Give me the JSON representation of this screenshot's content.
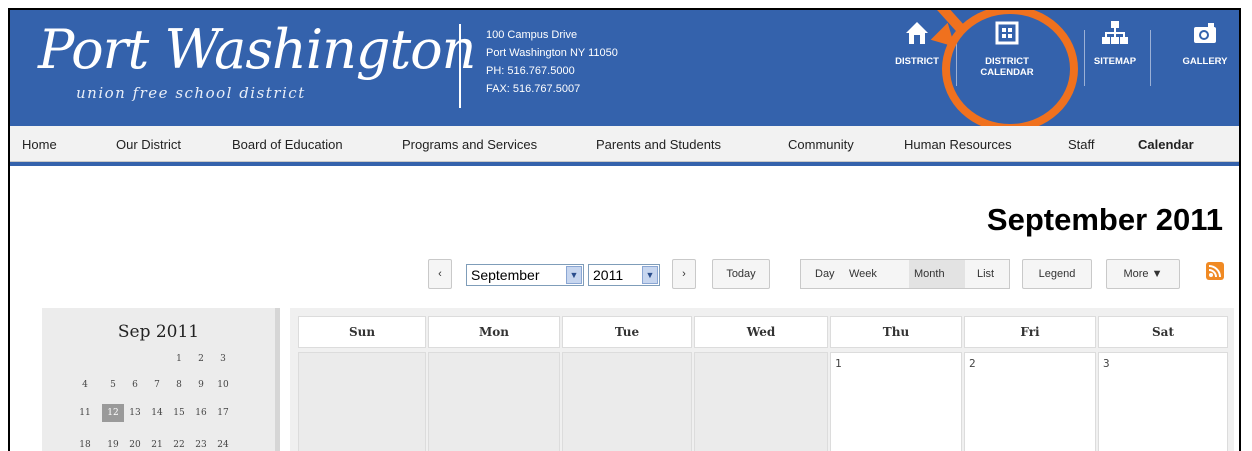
{
  "header": {
    "logo_main": "Port Washington",
    "logo_sub": "union free school district",
    "address": [
      "100 Campus Drive",
      "Port Washington NY 11050",
      "PH: 516.767.5000",
      "FAX: 516.767.5007"
    ],
    "links": [
      {
        "label": "DISTRICT",
        "icon": "house-icon"
      },
      {
        "label": "DISTRICT CALENDAR",
        "icon": "calendar-grid-icon"
      },
      {
        "label": "SITEMAP",
        "icon": "sitemap-icon"
      },
      {
        "label": "GALLERY",
        "icon": "camera-icon"
      }
    ],
    "highlight_color": "#f0711e",
    "bg_color": "#3462ac"
  },
  "nav": {
    "items": [
      "Home",
      "Our District",
      "Board of Education",
      "Programs and Services",
      "Parents and Students",
      "Community",
      "Human Resources",
      "Staff",
      "Calendar"
    ],
    "active": "Calendar"
  },
  "calendar": {
    "title": "September 2011",
    "prev": "‹",
    "next": "›",
    "month_select": "September",
    "year_select": "2011",
    "today": "Today",
    "views": [
      "Day",
      "Week",
      "Month",
      "List"
    ],
    "active_view": "Month",
    "legend": "Legend",
    "more": "More ▼",
    "rss": "RSS",
    "weekdays": [
      "Sun",
      "Mon",
      "Tue",
      "Wed",
      "Thu",
      "Fri",
      "Sat"
    ],
    "first_row": [
      "",
      "",
      "",
      "",
      "1",
      "2",
      "3"
    ]
  },
  "mini_calendar": {
    "title": "Sep 2011",
    "weeks": [
      [
        "",
        "",
        "",
        "",
        "1",
        "2",
        "3"
      ],
      [
        "4",
        "5",
        "6",
        "7",
        "8",
        "9",
        "10"
      ],
      [
        "11",
        "12",
        "13",
        "14",
        "15",
        "16",
        "17"
      ],
      [
        "18",
        "19",
        "20",
        "21",
        "22",
        "23",
        "24"
      ]
    ],
    "today": "12"
  }
}
